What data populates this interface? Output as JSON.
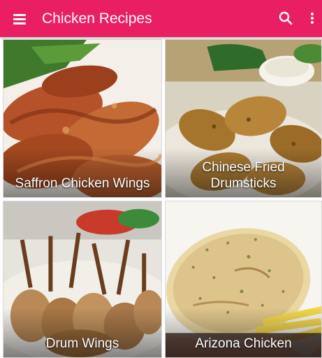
{
  "appbar": {
    "title": "Chicken Recipes",
    "menu_icon": "hamburger-menu-icon",
    "search_icon": "search-icon",
    "overflow_icon": "more-vertical-icon",
    "color": "#e91e63"
  },
  "recipes": [
    {
      "title_lines": [
        "Saffron Chicken Wings"
      ]
    },
    {
      "title_lines": [
        "Chinese Fried",
        "Drumsticks"
      ]
    },
    {
      "title_lines": [
        "Drum Wings"
      ]
    },
    {
      "title_lines": [
        "Arizona Chicken"
      ]
    }
  ]
}
